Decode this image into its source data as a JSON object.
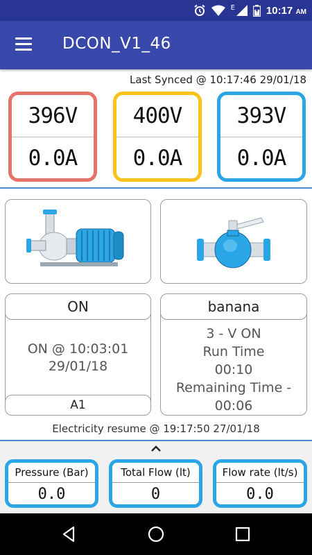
{
  "status_bar": {
    "time": "10:17",
    "ampm": "AM",
    "network_letter": "E"
  },
  "app_bar": {
    "title": "DCON_V1_46"
  },
  "sync": {
    "text": "Last Synced @ 10:17:46 29/01/18"
  },
  "meters": [
    {
      "voltage": "396V",
      "current": "0.0A",
      "color": "#e57368"
    },
    {
      "voltage": "400V",
      "current": "0.0A",
      "color": "#fbc21c"
    },
    {
      "voltage": "393V",
      "current": "0.0A",
      "color": "#2aa6e6"
    }
  ],
  "pump": {
    "status": "ON",
    "detail_line1": "ON @ 10:03:01",
    "detail_line2": "29/01/18",
    "footer": "A1"
  },
  "valve": {
    "name": "banana",
    "line1": "3 - V ON",
    "line2": "Run Time",
    "line3": "00:10",
    "line4": "Remaining Time -",
    "line5": "00:06"
  },
  "electricity": {
    "text": "Electricity resume @ 19:17:50 27/01/18"
  },
  "gauges": [
    {
      "label": "Pressure (Bar)",
      "value": "0.0"
    },
    {
      "label": "Total Flow (lt)",
      "value": "0"
    },
    {
      "label": "Flow rate (lt/s)",
      "value": "0.0"
    }
  ],
  "colors": {
    "primary": "#3949ab",
    "primary_dark": "#283593",
    "accent_blue": "#2aa6e6",
    "divider": "#4a8fd1"
  },
  "icons": [
    "alarm-icon",
    "wifi-icon",
    "signal-icon",
    "battery-icon",
    "menu-icon",
    "pump-icon",
    "valve-icon",
    "chevron-up-icon",
    "back-icon",
    "home-icon",
    "recents-icon"
  ]
}
